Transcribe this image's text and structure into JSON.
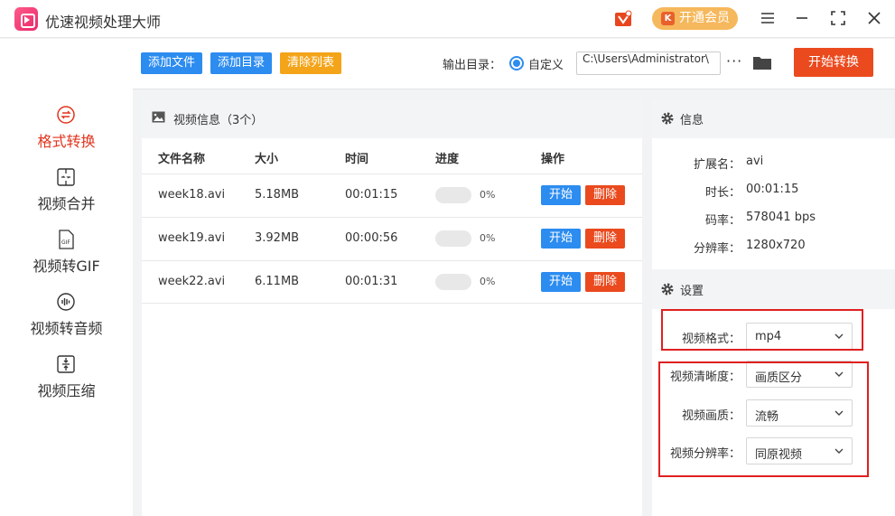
{
  "app": {
    "title": "优速视频处理大师"
  },
  "header": {
    "vip_label": "开通会员",
    "vip_k": "K",
    "icons": [
      "vip-badge-icon",
      "menu-icon",
      "minimize-icon",
      "fullscreen-icon",
      "close-icon"
    ]
  },
  "sidebar": {
    "items": [
      {
        "label": "格式转换",
        "icon": "format-convert-icon",
        "active": true
      },
      {
        "label": "视频合并",
        "icon": "video-merge-icon",
        "active": false
      },
      {
        "label": "视频转GIF",
        "icon": "gif-icon",
        "active": false
      },
      {
        "label": "视频转音频",
        "icon": "audio-icon",
        "active": false
      },
      {
        "label": "视频压缩",
        "icon": "compress-icon",
        "active": false
      }
    ]
  },
  "toolbar": {
    "add_file": "添加文件",
    "add_dir": "添加目录",
    "clear_list": "清除列表",
    "output_label": "输出目录：",
    "custom_label": "自定义",
    "path_value": "C:\\Users\\Administrator\\",
    "more": "···",
    "start_convert": "开始转换"
  },
  "list": {
    "title": "视频信息（3个）",
    "columns": [
      "文件名称",
      "大小",
      "时间",
      "进度",
      "操作"
    ],
    "rows": [
      {
        "name": "week18.avi",
        "size": "5.18MB",
        "time": "00:01:15",
        "progress": "0%",
        "start": "开始",
        "delete": "删除"
      },
      {
        "name": "week19.avi",
        "size": "3.92MB",
        "time": "00:00:56",
        "progress": "0%",
        "start": "开始",
        "delete": "删除"
      },
      {
        "name": "week22.avi",
        "size": "6.11MB",
        "time": "00:01:31",
        "progress": "0%",
        "start": "开始",
        "delete": "删除"
      }
    ]
  },
  "info": {
    "title": "信息",
    "ext_label": "扩展名：",
    "ext_value": "avi",
    "dur_label": "时长：",
    "dur_value": "00:01:15",
    "bitrate_label": "码率：",
    "bitrate_value": "578041 bps",
    "res_label": "分辨率：",
    "res_value": "1280x720"
  },
  "settings": {
    "title": "设置",
    "format_label": "视频格式：",
    "format_value": "mp4",
    "clarity_label": "视频清晰度：",
    "clarity_value": "画质区分",
    "quality_label": "视频画质：",
    "quality_value": "流畅",
    "resolution_label": "视频分辨率：",
    "resolution_value": "同原视频"
  },
  "colors": {
    "accent_blue": "#2c8cf0",
    "accent_red": "#ea4a1e",
    "accent_orange": "#f4a419",
    "highlight": "#e02020"
  }
}
